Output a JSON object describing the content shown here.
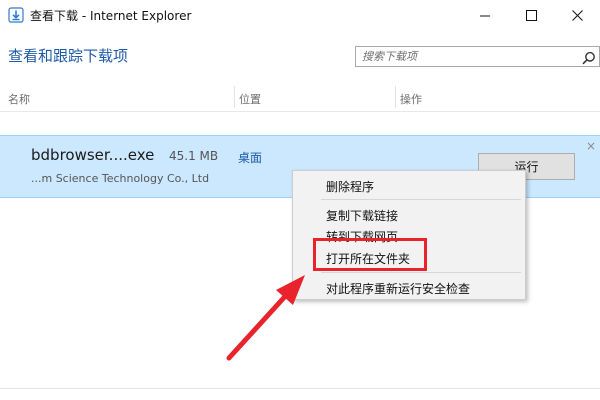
{
  "window": {
    "title": "查看下载 - Internet Explorer",
    "app_icon": "download-window-icon",
    "minimize_icon": "minimize-icon",
    "maximize_icon": "maximize-icon",
    "close_icon": "close-icon"
  },
  "header": {
    "title": "查看和跟踪下载项",
    "search_placeholder": "搜索下载项",
    "search_icon": "search-icon"
  },
  "columns": {
    "name": "名称",
    "location": "位置",
    "actions": "操作"
  },
  "download": {
    "file_name": "bdbrowser....exe",
    "size": "45.1 MB",
    "location": "桌面",
    "publisher": "...m Science Technology Co., Ltd",
    "run_label": "运行",
    "dismiss_glyph": "×"
  },
  "context_menu": {
    "items": [
      "删除程序",
      "复制下载链接",
      "转到下载网页",
      "打开所在文件夹",
      "对此程序重新运行安全检查"
    ]
  },
  "annotation": {
    "highlight_color": "#e8232c",
    "arrow_color": "#e8232c",
    "highlighted_item": "打开所在文件夹"
  },
  "colors": {
    "accent_text": "#1e5aa8",
    "row_selected_bg": "#cce8ff"
  }
}
